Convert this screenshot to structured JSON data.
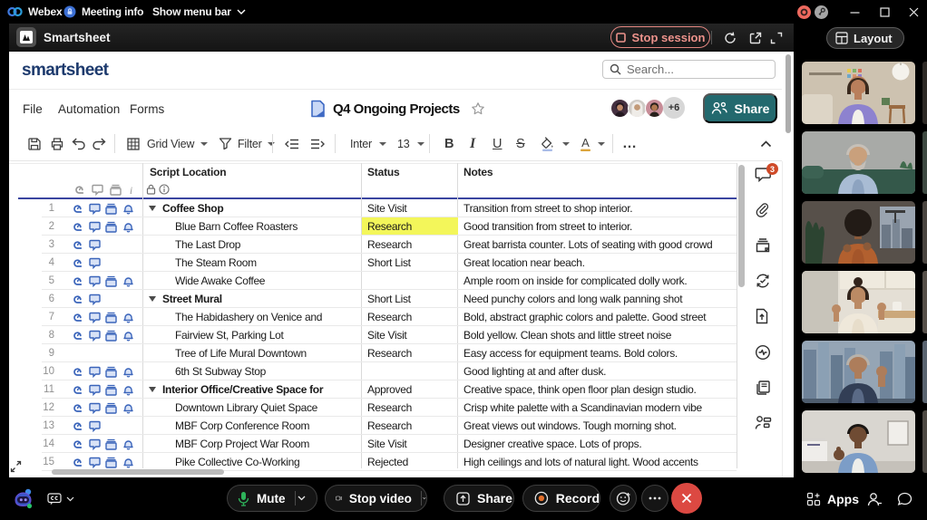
{
  "window": {
    "brand": "Webex",
    "meeting_info_label": "Meeting info",
    "menu_toggle_label": "Show menu bar",
    "controls": [
      "recording-indicator",
      "key-indicator",
      "minimize",
      "maximize",
      "close"
    ]
  },
  "app_header": {
    "title": "Smartsheet",
    "stop_session_label": "Stop session",
    "actions": [
      "refresh",
      "open-external",
      "expand"
    ]
  },
  "smartsheet": {
    "wordmark": "smartsheet",
    "search_placeholder": "Search...",
    "menus": {
      "file": "File",
      "automation": "Automation",
      "forms": "Forms"
    },
    "doc_title": "Q4 Ongoing Projects",
    "collaborators_overflow": "+6",
    "share_label": "Share",
    "toolbar": {
      "view_label": "Grid View",
      "filter_label": "Filter",
      "font_name": "Inter",
      "font_size": "13",
      "bold": "B",
      "italic": "I",
      "underline": "U",
      "strikethrough": "S",
      "more_label": "…"
    },
    "columns": {
      "location": "Script Location",
      "status": "Status",
      "notes": "Notes"
    },
    "rows": [
      {
        "num": 1,
        "icons": 4,
        "parent": true,
        "location": "Coffee Shop",
        "status": "Site Visit",
        "highlight": false,
        "notes": "Transition from street to shop interior."
      },
      {
        "num": 2,
        "icons": 4,
        "parent": false,
        "location": "Blue Barn Coffee Roasters",
        "status": "Research",
        "highlight": true,
        "notes": "Good transition from street to interior."
      },
      {
        "num": 3,
        "icons": 2,
        "parent": false,
        "location": "The Last Drop",
        "status": "Research",
        "highlight": false,
        "notes": "Great barrista counter. Lots of seating with good crowd"
      },
      {
        "num": 4,
        "icons": 2,
        "parent": false,
        "location": "The Steam Room",
        "status": "Short List",
        "highlight": false,
        "notes": "Great location near beach."
      },
      {
        "num": 5,
        "icons": 4,
        "parent": false,
        "location": "Wide Awake Coffee",
        "status": "",
        "highlight": false,
        "notes": "Ample room on inside for complicated dolly work."
      },
      {
        "num": 6,
        "icons": 2,
        "parent": true,
        "location": "Street Mural",
        "status": "Short List",
        "highlight": false,
        "notes": "Need punchy colors and long walk panning shot"
      },
      {
        "num": 7,
        "icons": 4,
        "parent": false,
        "location": "The Habidashery on Venice and",
        "status": "Research",
        "highlight": false,
        "notes": "Bold, abstract graphic colors and palette. Good street"
      },
      {
        "num": 8,
        "icons": 4,
        "parent": false,
        "location": "Fairview St, Parking Lot",
        "status": "Site Visit",
        "highlight": false,
        "notes": "Bold yellow. Clean shots and little street noise"
      },
      {
        "num": 9,
        "icons": 0,
        "parent": false,
        "location": "Tree of Life Mural Downtown",
        "status": "Research",
        "highlight": false,
        "notes": "Easy access for equipment teams. Bold colors."
      },
      {
        "num": 10,
        "icons": 4,
        "parent": false,
        "location": "6th St Subway Stop",
        "status": "",
        "highlight": false,
        "notes": "Good lighting at and after dusk."
      },
      {
        "num": 11,
        "icons": 4,
        "parent": true,
        "location": "Interior Office/Creative Space for",
        "status": "Approved",
        "highlight": false,
        "notes": "Creative space, think open floor plan design studio."
      },
      {
        "num": 12,
        "icons": 4,
        "parent": false,
        "location": "Downtown Library Quiet Space",
        "status": "Research",
        "highlight": false,
        "notes": "Crisp white palette with a Scandinavian modern vibe"
      },
      {
        "num": 13,
        "icons": 2,
        "parent": false,
        "location": "MBF Corp Conference Room",
        "status": "Research",
        "highlight": false,
        "notes": "Great views out windows. Tough morning shot."
      },
      {
        "num": 14,
        "icons": 4,
        "parent": false,
        "location": "MBF Corp Project War Room",
        "status": "Site Visit",
        "highlight": false,
        "notes": "Designer creative space. Lots of props."
      },
      {
        "num": 15,
        "icons": 4,
        "parent": false,
        "location": "Pike Collective Co-Working",
        "status": "Rejected",
        "highlight": false,
        "notes": "High ceilings and lots of natural light. Wood accents"
      }
    ],
    "right_rail": {
      "badge_count": "3",
      "icons": [
        "conversations",
        "attachments",
        "proofs",
        "update-requests",
        "publish",
        "activity-log",
        "summary",
        "contacts"
      ]
    }
  },
  "video_panel": {
    "layout_label": "Layout",
    "participants": [
      {
        "desc": "woman in lavender shirt in beige living room",
        "scene": "home",
        "bg": "#cdc2b0",
        "skin": "#b97f5c",
        "hair": "#3a2a1e",
        "shirt": "#8d82cf",
        "tee": "#f2f0ea"
      },
      {
        "desc": "gray-haired man on dark green sofa",
        "scene": "sofa",
        "bg": "#a8aaa7",
        "skin": "#c9a07c",
        "hair": "#c6c0b8",
        "shirt": "#a9bcd4",
        "tee": "#8da3c0"
      },
      {
        "desc": "woman with curly hair in dark room",
        "scene": "dark",
        "bg": "#57504a",
        "skin": "#8a5a3a",
        "hair": "#221b16",
        "shirt": "#b2602f",
        "tee": "#a4552a"
      },
      {
        "desc": "woman gesturing in white kitchen",
        "scene": "kitchen",
        "bg": "#e4dfd5",
        "skin": "#bb8a64",
        "hair": "#32241b",
        "shirt": "#efe8da",
        "tee": "#e7ddca"
      },
      {
        "desc": "man in navy blazer against city skyline",
        "scene": "city",
        "bg": "#95a5b5",
        "skin": "#ad7d5b",
        "hair": "#b7b2ab",
        "shirt": "#323e55",
        "tee": "#5a6a86"
      },
      {
        "desc": "man in denim shirt giving thumbs up",
        "scene": "office",
        "bg": "#d9d6d0",
        "skin": "#6f4b33",
        "hair": "#1a1613",
        "shirt": "#7c9dc7",
        "tee": "#eeeeea"
      }
    ],
    "sliver_colors": [
      "#2e2a26",
      "#3e4a42",
      "#4a4540",
      "#56504a",
      "#5a6470",
      "#4e4a44"
    ]
  },
  "call_controls": {
    "mute_label": "Mute",
    "stop_video_label": "Stop video",
    "share_label": "Share",
    "record_label": "Record",
    "apps_label": "Apps",
    "mic_color": "#2eb35a",
    "record_dot_color": "#e2702c",
    "end_color": "#dc4942"
  },
  "avatars": [
    {
      "desc": "woman with dark hair",
      "bg": "#453040",
      "skin": "#c08a6a",
      "hair": "#241820"
    },
    {
      "desc": "woman in white hijab",
      "bg": "#cfcbc6",
      "skin": "#c29a78",
      "hair": "#efece8"
    },
    {
      "desc": "man with dark hair",
      "bg": "#c88d98",
      "skin": "#b07850",
      "hair": "#27201b"
    }
  ],
  "theme": {
    "status_highlight": "#f3f65a",
    "row_icon_blue": "#3a64ba",
    "header_rule_blue": "#3a45a0",
    "share_teal": "#23696e",
    "stop_session_red": "#ec928b",
    "wordmark_navy": "#1d3a6d"
  }
}
